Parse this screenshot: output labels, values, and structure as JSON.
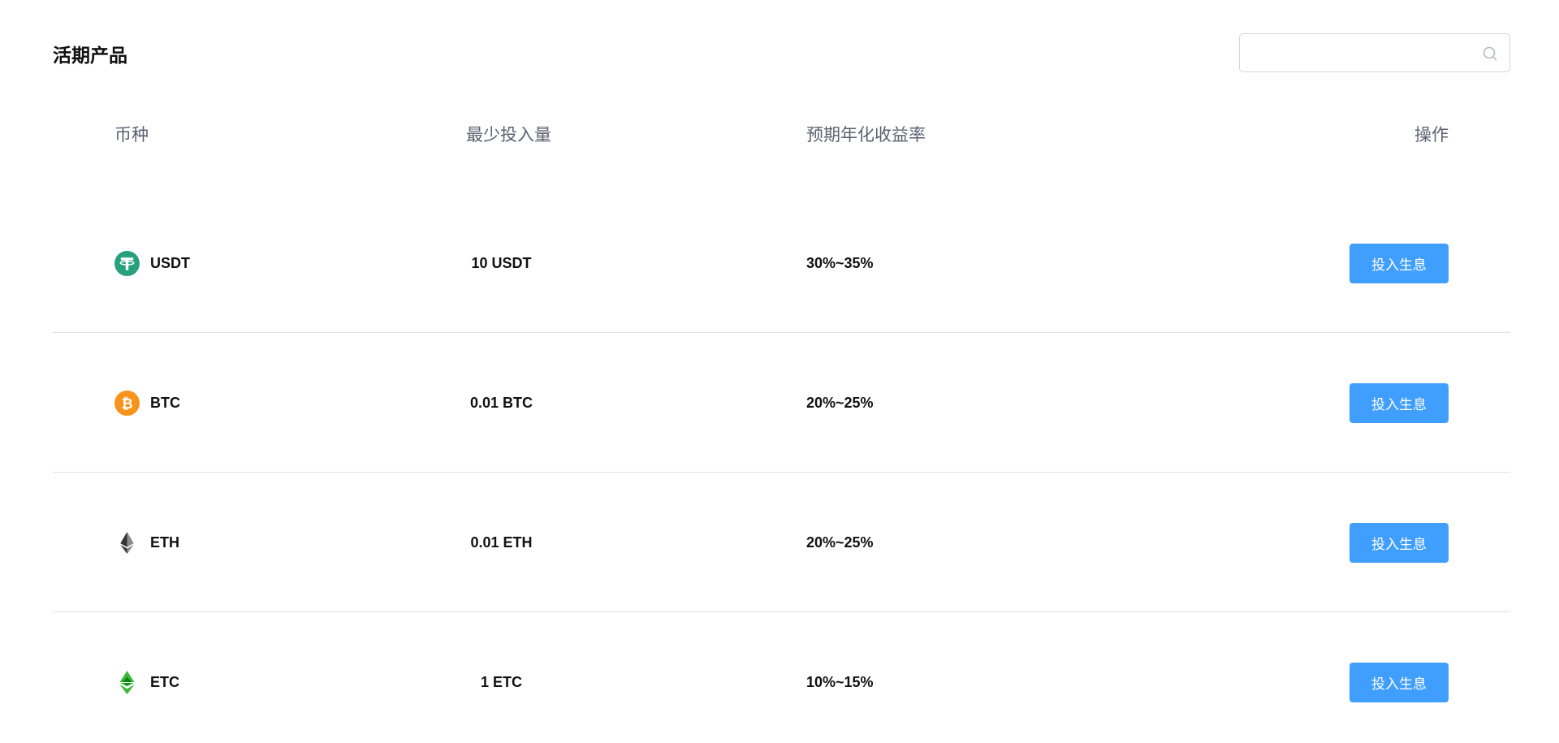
{
  "page_title": "活期产品",
  "search": {
    "value": "",
    "placeholder": "",
    "icon": "search-icon"
  },
  "table": {
    "headers": [
      "币种",
      "最少投入量",
      "预期年化收益率",
      "操作"
    ],
    "rows": [
      {
        "coin": "USDT",
        "icon": "usdt-icon",
        "min": "10 USDT",
        "rate": "30%~35%",
        "action": "投入生息"
      },
      {
        "coin": "BTC",
        "icon": "btc-icon",
        "min": "0.01 BTC",
        "rate": "20%~25%",
        "action": "投入生息"
      },
      {
        "coin": "ETH",
        "icon": "eth-icon",
        "min": "0.01 ETH",
        "rate": "20%~25%",
        "action": "投入生息"
      },
      {
        "coin": "ETC",
        "icon": "etc-icon",
        "min": "1 ETC",
        "rate": "10%~15%",
        "action": "投入生息"
      }
    ]
  },
  "colors": {
    "primary_button": "#409eff",
    "usdt": "#26a17b",
    "btc": "#f7931a",
    "etc": "#3ab83a",
    "eth": "#343434"
  }
}
